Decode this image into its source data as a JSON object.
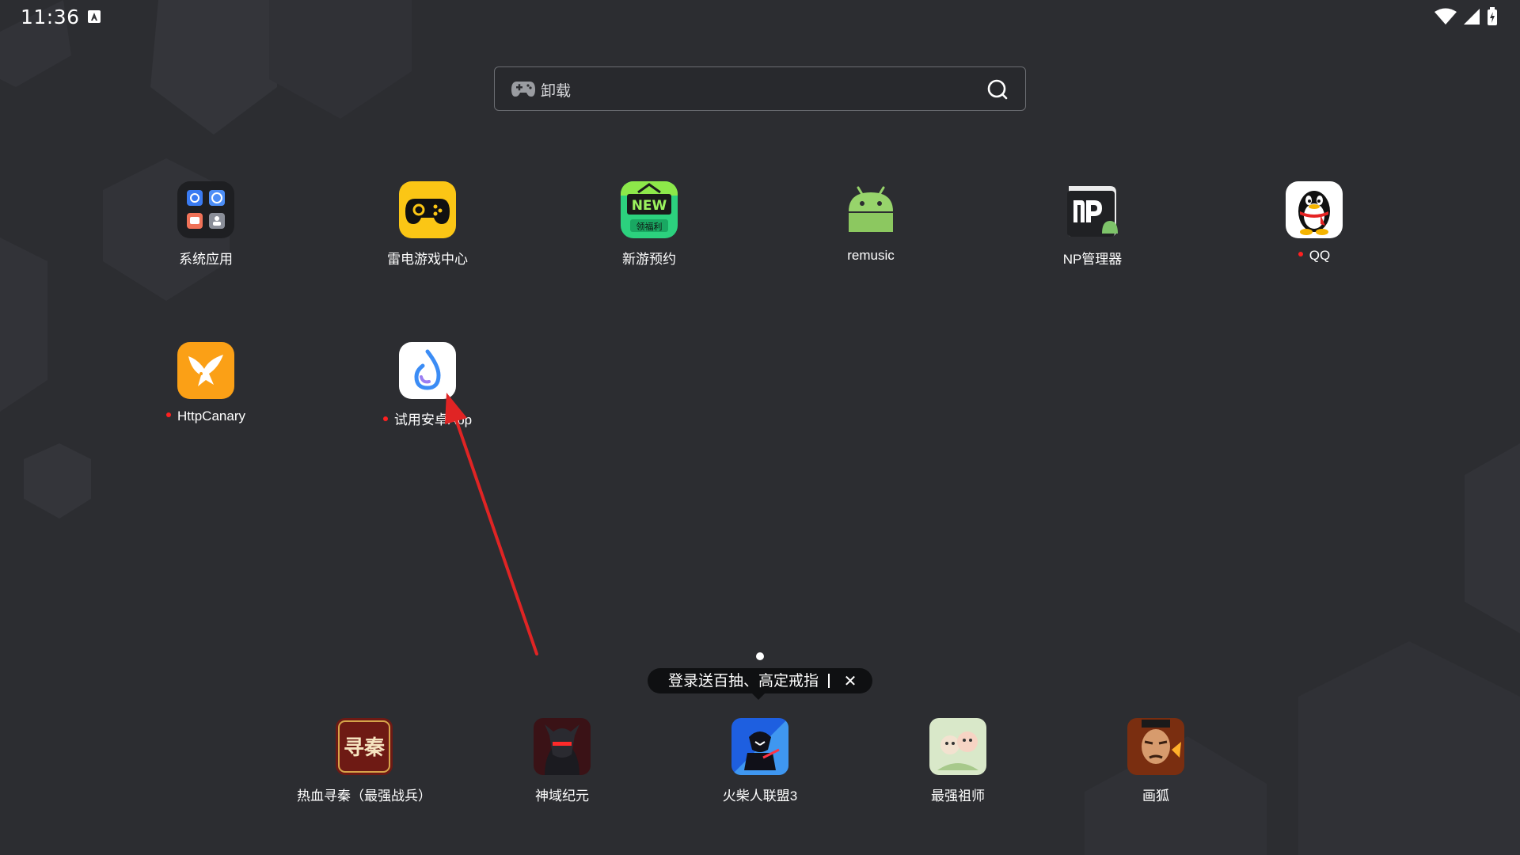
{
  "status_bar": {
    "time": "11:36"
  },
  "search": {
    "query": "卸载"
  },
  "apps": [
    {
      "label": "系统应用",
      "badge": false
    },
    {
      "label": "雷电游戏中心",
      "badge": false
    },
    {
      "label": "新游预约",
      "badge": false,
      "icon_text_top": "NEW",
      "icon_text_bottom": "领福利"
    },
    {
      "label": "remusic",
      "badge": false
    },
    {
      "label": "NP管理器",
      "badge": false
    },
    {
      "label": "QQ",
      "badge": true
    },
    {
      "label": "HttpCanary",
      "badge": true
    },
    {
      "label": "试用安卓App",
      "badge": true
    }
  ],
  "promo": {
    "text": "登录送百抽、高定戒指",
    "close": "✕"
  },
  "dock": [
    {
      "label": "热血寻秦（最强战兵）",
      "icon_text": "寻秦"
    },
    {
      "label": "神域纪元"
    },
    {
      "label": "火柴人联盟3"
    },
    {
      "label": "最强祖师"
    },
    {
      "label": "画狐"
    }
  ],
  "colors": {
    "background": "#2c2d31",
    "tooltip_bg": "#0f1012",
    "badge_dot": "#ff2020",
    "arrow": "#e02424"
  }
}
